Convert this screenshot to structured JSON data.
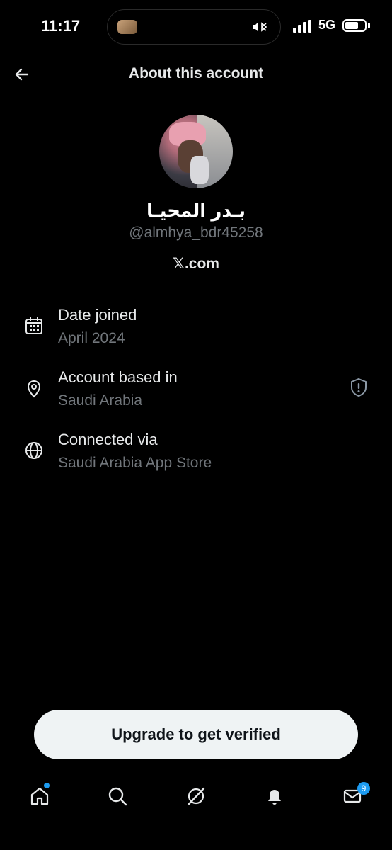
{
  "status": {
    "time": "11:17",
    "network": "5G"
  },
  "header": {
    "title": "About this account"
  },
  "profile": {
    "display_name": "بـدر المحيـا",
    "handle": "@almhya_bdr45258",
    "website": "𝕏.com"
  },
  "info": [
    {
      "label": "Date joined",
      "value": "April 2024",
      "icon": "calendar-icon"
    },
    {
      "label": "Account based in",
      "value": "Saudi Arabia",
      "icon": "location-pin-icon"
    },
    {
      "label": "Connected via",
      "value": "Saudi Arabia App Store",
      "icon": "globe-icon"
    }
  ],
  "upgrade": {
    "label": "Upgrade to get verified"
  },
  "tabbar": {
    "messages_badge": "9"
  },
  "colors": {
    "background": "#000000",
    "text_primary": "#e7e9ea",
    "text_secondary": "#71767b",
    "accent": "#1d9bf0",
    "button_bg": "#eff3f4"
  }
}
